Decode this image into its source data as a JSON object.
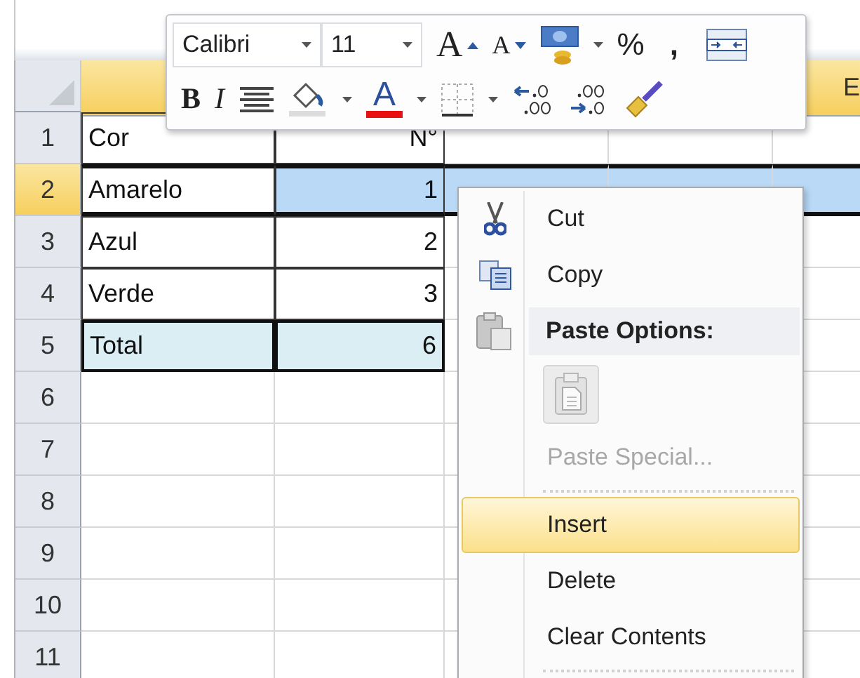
{
  "toolbar": {
    "font": {
      "value": "Calibri"
    },
    "size": {
      "value": "11"
    },
    "grow_font": "A",
    "shrink_font": "A",
    "percent": "%",
    "comma": ",",
    "bold": "B",
    "italic": "I",
    "font_color": {
      "letter": "A",
      "color": "#e81010"
    }
  },
  "column_header": {
    "label": "E",
    "selected": true
  },
  "rows": [
    {
      "header": "1",
      "selected": false,
      "kind": "data",
      "cells": [
        {
          "text": "Cor",
          "active": false
        },
        {
          "text": "N°",
          "active": false
        }
      ]
    },
    {
      "header": "2",
      "selected": true,
      "kind": "data",
      "cells": [
        {
          "text": "Amarelo",
          "active": true
        },
        {
          "text": "1",
          "active": false
        }
      ]
    },
    {
      "header": "3",
      "selected": false,
      "kind": "data",
      "cells": [
        {
          "text": "Azul",
          "active": false
        },
        {
          "text": "2",
          "active": false
        }
      ]
    },
    {
      "header": "4",
      "selected": false,
      "kind": "data",
      "cells": [
        {
          "text": "Verde",
          "active": false
        },
        {
          "text": "3",
          "active": false
        }
      ]
    },
    {
      "header": "5",
      "selected": false,
      "kind": "total",
      "cells": [
        {
          "text": "Total",
          "active": false
        },
        {
          "text": "6",
          "active": false
        }
      ]
    },
    {
      "header": "6",
      "selected": false,
      "kind": "empty"
    },
    {
      "header": "7",
      "selected": false,
      "kind": "empty"
    },
    {
      "header": "8",
      "selected": false,
      "kind": "empty"
    },
    {
      "header": "9",
      "selected": false,
      "kind": "empty"
    },
    {
      "header": "10",
      "selected": false,
      "kind": "empty"
    },
    {
      "header": "11",
      "selected": false,
      "kind": "empty"
    }
  ],
  "context_menu": {
    "items": [
      {
        "kind": "cut",
        "label": "Cut",
        "disabled": false,
        "selected": false
      },
      {
        "kind": "copy",
        "label": "Copy",
        "disabled": false,
        "selected": false
      },
      {
        "kind": "heading",
        "label": "Paste Options:"
      },
      {
        "kind": "paste"
      },
      {
        "kind": "command",
        "label": "Paste Special...",
        "disabled": true,
        "selected": false
      },
      {
        "kind": "separator"
      },
      {
        "kind": "command",
        "label": "Insert",
        "disabled": false,
        "selected": true
      },
      {
        "kind": "command",
        "label": "Delete",
        "disabled": false,
        "selected": false
      },
      {
        "kind": "command",
        "label": "Clear Contents",
        "disabled": false,
        "selected": false
      },
      {
        "kind": "separator"
      }
    ]
  }
}
